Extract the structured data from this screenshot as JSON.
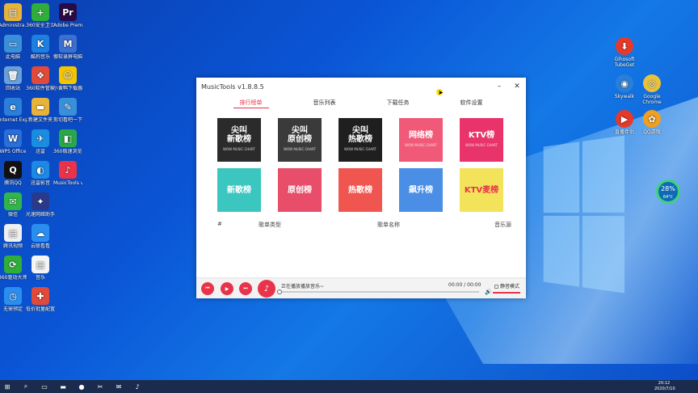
{
  "desktop": {
    "left_icons": [
      {
        "label": "Administra...",
        "icon": "user-folder-icon",
        "color": "#e8b33a",
        "glyph": "▤"
      },
      {
        "label": "360安全卫士",
        "icon": "360-guard-icon",
        "color": "#2fae3a",
        "glyph": "+"
      },
      {
        "label": "Adobe Premie...",
        "icon": "premiere-icon",
        "color": "#2a0b4a",
        "glyph": "Pr"
      },
      {
        "label": "此电脑",
        "icon": "computer-icon",
        "color": "#3a8fd9",
        "glyph": "▭"
      },
      {
        "label": "酷狗音乐",
        "icon": "kugou-icon",
        "color": "#1e7fe0",
        "glyph": "K"
      },
      {
        "label": "傲软录屏电脑版 V1.4...",
        "icon": "recorder-icon",
        "color": "#3b6fd0",
        "glyph": "M"
      },
      {
        "label": "回收站",
        "icon": "recycle-bin-icon",
        "color": "#6aa0d8",
        "glyph": "🗑"
      },
      {
        "label": "360软件管家",
        "icon": "360-software-icon",
        "color": "#e04a3a",
        "glyph": "❖"
      },
      {
        "label": "小黄鸭下载器",
        "icon": "duck-downloader-icon",
        "color": "#f2c500",
        "glyph": "☺"
      },
      {
        "label": "Internet Explorer",
        "icon": "ie-icon",
        "color": "#2a7fd8",
        "glyph": "e"
      },
      {
        "label": "新建文件夹",
        "icon": "folder-icon",
        "color": "#e8b33a",
        "glyph": "▬"
      },
      {
        "label": "剪切看吧一下",
        "icon": "cut-icon",
        "color": "#3a8fd9",
        "glyph": "✎"
      },
      {
        "label": "WPS Office",
        "icon": "wps-icon",
        "color": "#2a6ed8",
        "glyph": "W"
      },
      {
        "label": "迅雷",
        "icon": "xunlei-icon",
        "color": "#1a8de0",
        "glyph": "✈"
      },
      {
        "label": "360极速浏览器",
        "icon": "360-browser-icon",
        "color": "#29a84a",
        "glyph": "◧"
      },
      {
        "label": "腾讯QQ",
        "icon": "qq-icon",
        "color": "#111111",
        "glyph": "Q"
      },
      {
        "label": "迅雷影音",
        "icon": "xunlei-player-icon",
        "color": "#1e88e5",
        "glyph": "◐"
      },
      {
        "label": "MusicTools v1.8.8.5",
        "icon": "musictools-icon",
        "color": "#e8334a",
        "glyph": "♪"
      },
      {
        "label": "微信",
        "icon": "wechat-icon",
        "color": "#2fb54a",
        "glyph": "✉"
      },
      {
        "label": "光速网络助手",
        "icon": "network-icon",
        "color": "#2a3a8a",
        "glyph": "✦"
      },
      {
        "label": "",
        "icon": "blank-icon",
        "color": "transparent",
        "glyph": ""
      },
      {
        "label": "腾讯视频",
        "icon": "document-exe-icon",
        "color": "#f0f0f0",
        "glyph": "▤"
      },
      {
        "label": "云联看看",
        "icon": "baidu-netdisk-icon",
        "color": "#2a8ef0",
        "glyph": "☁"
      },
      {
        "label": "",
        "icon": "blank-icon",
        "color": "transparent",
        "glyph": ""
      },
      {
        "label": "360驱动大师网卡版",
        "icon": "360-driver-icon",
        "color": "#2fae3a",
        "glyph": "⟳"
      },
      {
        "label": "音乐",
        "icon": "text-file-icon",
        "color": "#f5f5f5",
        "glyph": "▤"
      },
      {
        "label": "",
        "icon": "blank-icon",
        "color": "transparent",
        "glyph": ""
      },
      {
        "label": "无需预定",
        "icon": "clock-icon",
        "color": "#2a8ef0",
        "glyph": "◷"
      },
      {
        "label": "低价批量配置 纸箱V2.0",
        "icon": "pinwheel-icon",
        "color": "#e04a3a",
        "glyph": "✚"
      }
    ],
    "right_icons": [
      {
        "label": "Gihosoft TubeGet",
        "icon": "tubeget-icon",
        "color": "#e53a2a",
        "glyph": "⬇"
      },
      {
        "label": "Skywalk",
        "icon": "skywalk-icon",
        "color": "#2a7fd8",
        "glyph": "◉"
      },
      {
        "label": "Google Chrome",
        "icon": "chrome-icon",
        "color": "#e9c23a",
        "glyph": "◎"
      },
      {
        "label": "直播伴侣",
        "icon": "live-companion-icon",
        "color": "#e53a2a",
        "glyph": "▶"
      },
      {
        "label": "QQ游戏",
        "icon": "qq-game-icon",
        "color": "#f0a020",
        "glyph": "✿"
      }
    ],
    "widget": {
      "value": "28",
      "unit": "%",
      "sub": "64°C"
    }
  },
  "app": {
    "title": "MusicTools v1.8.8.5",
    "minimize": "–",
    "close": "✕",
    "tabs": [
      {
        "label": "排行榜单",
        "active": true
      },
      {
        "label": "音乐列表",
        "active": false
      },
      {
        "label": "下载任务",
        "active": false
      },
      {
        "label": "软件设置",
        "active": false
      }
    ],
    "tiles": [
      {
        "line1": "尖叫",
        "line2": "新歌榜",
        "sub": "WOW MUSIC CHART",
        "badge": "",
        "color": "#2b2b2b"
      },
      {
        "line1": "尖叫",
        "line2": "原创榜",
        "sub": "WOW MUSIC CHART",
        "badge": "",
        "color": "#3a3a3a"
      },
      {
        "line1": "尖叫",
        "line2": "热歌榜",
        "sub": "WOW MUSIC CHART",
        "badge": "",
        "color": "#1f1f1f"
      },
      {
        "line1": "",
        "line2": "网络榜",
        "sub": "WOW MUSIC CHART",
        "badge": "",
        "color": "#f05a78"
      },
      {
        "line1": "",
        "line2": "KTV榜",
        "sub": "WOW MUSIC CHART",
        "badge": "",
        "color": "#e8346a"
      },
      {
        "line1": "",
        "line2": "新歌榜",
        "sub": "",
        "badge": "",
        "color": "#3bc7c0"
      },
      {
        "line1": "",
        "line2": "原创榜",
        "sub": "",
        "badge": "",
        "color": "#e84d6a"
      },
      {
        "line1": "",
        "line2": "热歌榜",
        "sub": "",
        "badge": "",
        "color": "#f0564f"
      },
      {
        "line1": "",
        "line2": "飙升榜",
        "sub": "",
        "badge": "",
        "color": "#4a8ee6"
      },
      {
        "line1": "",
        "line2": "KTV麦榜",
        "sub": "",
        "badge": "",
        "color": "#f2e35a"
      }
    ],
    "columns": {
      "index": "#",
      "type": "歌单类型",
      "name": "歌单名称",
      "source": "音乐源"
    },
    "player": {
      "prev": "⏮",
      "play": "▶",
      "next": "⏭",
      "now_playing": "正在播放播放音乐~",
      "time": "00:00 / 00:00",
      "mute_label": "静音模式",
      "volume_icon": "🔊",
      "progress": 0
    }
  },
  "taskbar": {
    "items": [
      {
        "icon": "start-icon",
        "glyph": "⊞"
      },
      {
        "icon": "search-icon",
        "glyph": "⌕"
      },
      {
        "icon": "task-view-icon",
        "glyph": "▭"
      },
      {
        "icon": "file-explorer-icon",
        "glyph": "▬"
      },
      {
        "icon": "360-taskbar-icon",
        "glyph": "●"
      },
      {
        "icon": "screenshot-icon",
        "glyph": "✂"
      },
      {
        "icon": "wechat-taskbar-icon",
        "glyph": "✉"
      },
      {
        "icon": "musictools-taskbar-icon",
        "glyph": "♪"
      }
    ],
    "time": "20:12",
    "date": "2020/7/10"
  }
}
